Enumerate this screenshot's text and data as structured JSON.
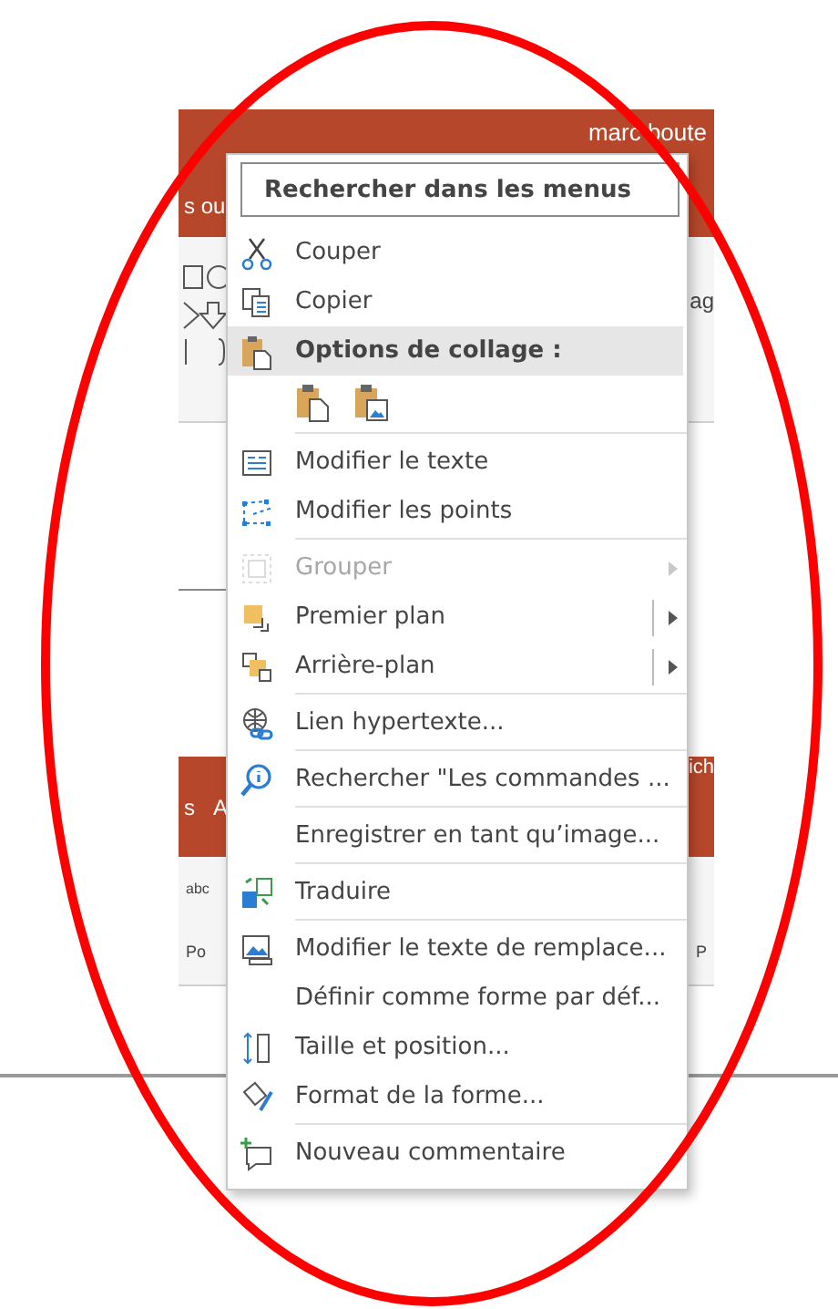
{
  "app_background": {
    "user_name": "marc boute",
    "tab_fragment": "s ou",
    "ribbon_fragment": "ag",
    "lower_tabs": [
      "s",
      "A"
    ],
    "lower_tab_right": "ich",
    "lower_ribbon_text": "abc",
    "lower_group_left": "Po",
    "lower_group_right": "P"
  },
  "context_menu": {
    "search": {
      "placeholder": "Rechercher dans les menus"
    },
    "items": [
      {
        "kind": "item",
        "label": "Couper",
        "disabled": false,
        "submenu": false,
        "split": false,
        "separator_before": false
      },
      {
        "kind": "item",
        "label": "Copier",
        "disabled": false,
        "submenu": false,
        "split": false,
        "separator_before": false
      },
      {
        "kind": "header",
        "label": "Options de collage :",
        "disabled": false,
        "submenu": false,
        "split": false,
        "separator_before": false
      },
      {
        "kind": "paste-options"
      },
      {
        "kind": "item",
        "label": "Modifier le texte",
        "disabled": false,
        "submenu": false,
        "split": false,
        "separator_before": true
      },
      {
        "kind": "item",
        "label": "Modifier les points",
        "disabled": false,
        "submenu": false,
        "split": false,
        "separator_before": false
      },
      {
        "kind": "item",
        "label": "Grouper",
        "disabled": true,
        "submenu": true,
        "split": false,
        "separator_before": true
      },
      {
        "kind": "item",
        "label": "Premier plan",
        "disabled": false,
        "submenu": true,
        "split": true,
        "separator_before": false
      },
      {
        "kind": "item",
        "label": "Arrière-plan",
        "disabled": false,
        "submenu": true,
        "split": true,
        "separator_before": false
      },
      {
        "kind": "item",
        "label": "Lien hypertexte...",
        "disabled": false,
        "submenu": false,
        "split": false,
        "separator_before": true
      },
      {
        "kind": "item",
        "label": "Rechercher \"Les commandes ...",
        "disabled": false,
        "submenu": false,
        "split": false,
        "separator_before": true
      },
      {
        "kind": "item",
        "label": "Enregistrer en tant qu’image...",
        "disabled": false,
        "submenu": false,
        "split": false,
        "separator_before": true
      },
      {
        "kind": "item",
        "label": "Traduire",
        "disabled": false,
        "submenu": false,
        "split": false,
        "separator_before": true
      },
      {
        "kind": "item",
        "label": "Modifier le texte de remplace...",
        "disabled": false,
        "submenu": false,
        "split": false,
        "separator_before": true
      },
      {
        "kind": "item",
        "label": "Définir comme forme par déf...",
        "disabled": false,
        "submenu": false,
        "split": false,
        "separator_before": false
      },
      {
        "kind": "item",
        "label": "Taille et position...",
        "disabled": false,
        "submenu": false,
        "split": false,
        "separator_before": false
      },
      {
        "kind": "item",
        "label": "Format de la forme...",
        "disabled": false,
        "submenu": false,
        "split": false,
        "separator_before": false
      },
      {
        "kind": "item",
        "label": "Nouveau commentaire",
        "disabled": false,
        "submenu": false,
        "split": false,
        "separator_before": true
      }
    ]
  }
}
